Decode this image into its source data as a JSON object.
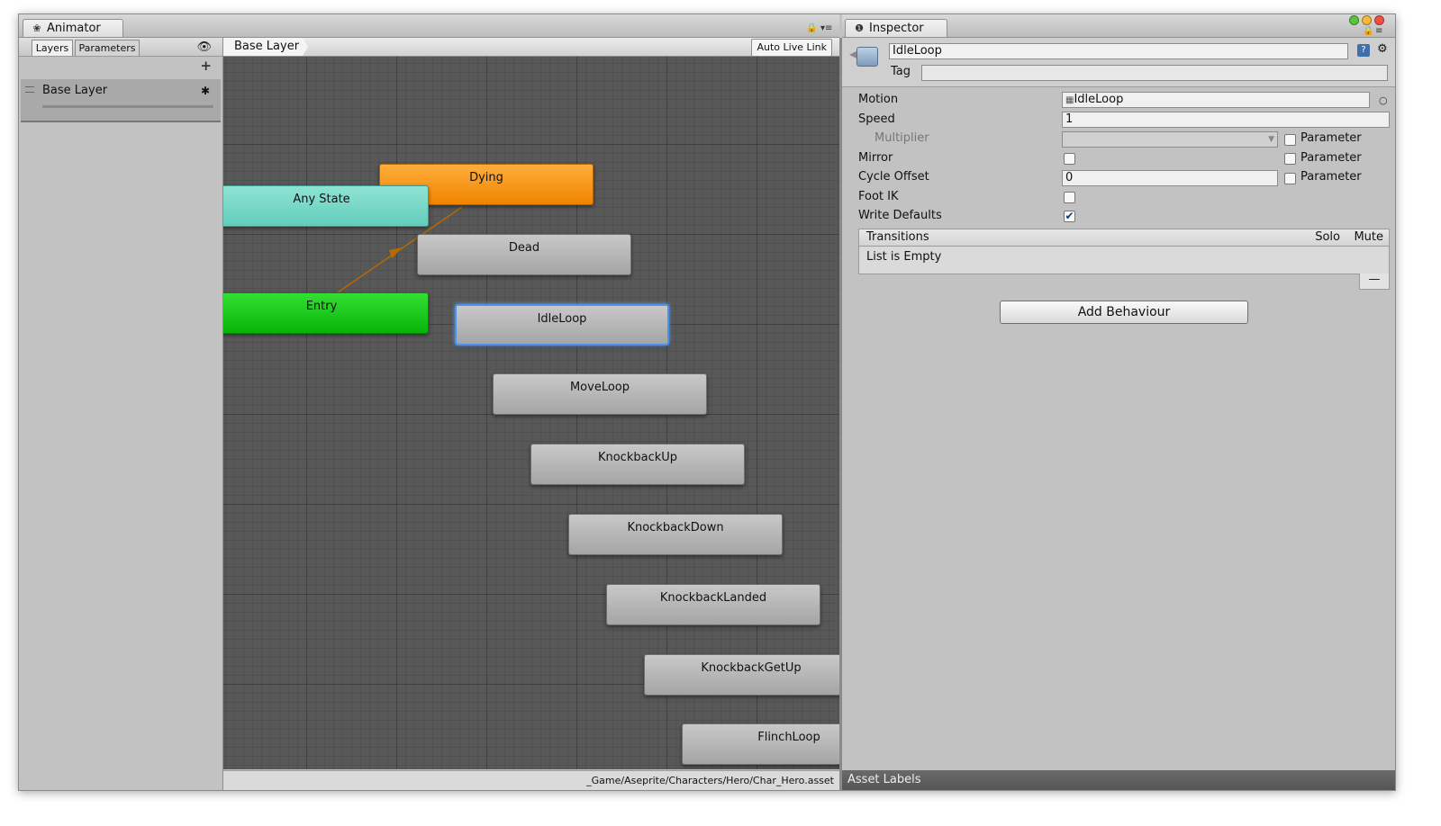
{
  "animator": {
    "tab_label": "Animator",
    "tab_icon": "animator-icon",
    "subtabs": {
      "layers": "Layers",
      "parameters": "Parameters"
    },
    "add_layer": "+",
    "layer": {
      "name": "Base Layer"
    },
    "breadcrumb": "Base Layer",
    "auto_live_link": "Auto Live Link",
    "asset_path": "_Game/Aseprite/Characters/Hero/Char_Hero.asset",
    "states": [
      {
        "name": "Dying",
        "kind": "default"
      },
      {
        "name": "Any State",
        "kind": "any"
      },
      {
        "name": "Dead",
        "kind": "normal"
      },
      {
        "name": "Entry",
        "kind": "entry"
      },
      {
        "name": "IdleLoop",
        "kind": "selected"
      },
      {
        "name": "MoveLoop",
        "kind": "normal"
      },
      {
        "name": "KnockbackUp",
        "kind": "normal"
      },
      {
        "name": "KnockbackDown",
        "kind": "normal"
      },
      {
        "name": "KnockbackLanded",
        "kind": "normal"
      },
      {
        "name": "KnockbackGetUp",
        "kind": "normal"
      },
      {
        "name": "FlinchLoop",
        "kind": "normal"
      }
    ],
    "colors": {
      "default_state": "#f08400",
      "any_state": "#62cdbb",
      "entry": "#06b306",
      "transition": "#b86a00",
      "selection": "#4d93e8"
    }
  },
  "inspector": {
    "tab_label": "Inspector",
    "tab_icon": "info-icon",
    "object_name": "IdleLoop",
    "tag_label": "Tag",
    "help_icon": "?",
    "properties": {
      "motion": {
        "label": "Motion",
        "value": "IdleLoop"
      },
      "speed": {
        "label": "Speed",
        "value": "1"
      },
      "multiplier": {
        "label": "Multiplier",
        "parameter": "Parameter"
      },
      "mirror": {
        "label": "Mirror",
        "parameter": "Parameter"
      },
      "cycle_offset": {
        "label": "Cycle Offset",
        "value": "0",
        "parameter": "Parameter"
      },
      "foot_ik": {
        "label": "Foot IK"
      },
      "write_defaults": {
        "label": "Write Defaults",
        "checked": "✔"
      }
    },
    "transitions": {
      "header": "Transitions",
      "solo": "Solo",
      "mute": "Mute",
      "empty": "List is Empty",
      "remove": "—"
    },
    "add_behaviour": "Add Behaviour",
    "asset_labels": "Asset Labels"
  }
}
